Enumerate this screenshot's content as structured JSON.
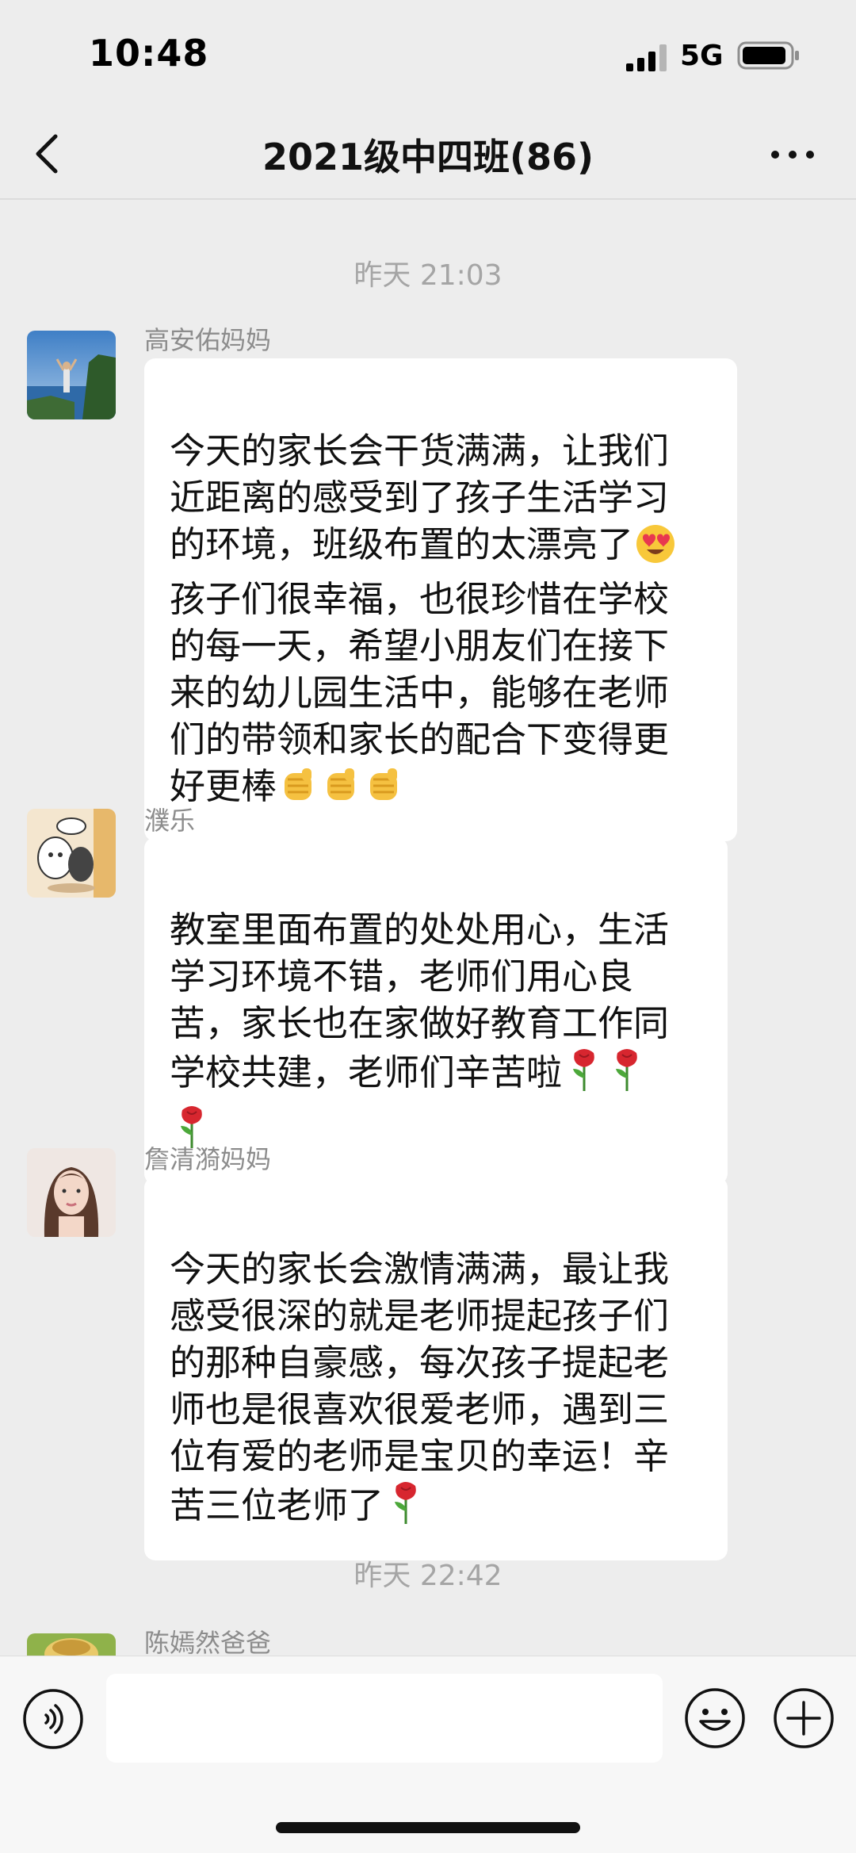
{
  "status_bar": {
    "time": "10:48",
    "network": "5G",
    "signal_icon": "signal-bars-icon",
    "battery_icon": "battery-icon"
  },
  "nav": {
    "title": "2021级中四班(86)",
    "back_icon": "chevron-left-icon",
    "more_icon": "more-dots-icon"
  },
  "messages": [
    {
      "timestamp": "昨天 21:03",
      "sender": "高安佑妈妈",
      "avatar": "landscape-photo-avatar",
      "text": "今天的家长会干货满满，让我们\n近距离的感受到了孩子生活学习\n的环境，班级布置的太漂亮了",
      "text2": "孩子们很幸福，也很珍惜在学校\n的每一天，希望小朋友们在接下\n来的幼儿园生活中，能够在老师\n们的带领和家长的配合下变得更\n好更棒",
      "emojis": [
        "heart-eyes-emoji",
        "fist-emoji",
        "fist-emoji",
        "fist-emoji"
      ]
    },
    {
      "sender": "濮乐",
      "avatar": "cartoon-animals-avatar",
      "text": "教室里面布置的处处用心，生活\n学习环境不错，老师们用心良\n苦，家长也在家做好教育工作同\n学校共建，老师们辛苦啦",
      "emojis": [
        "rose-emoji",
        "rose-emoji",
        "rose-emoji"
      ]
    },
    {
      "sender": "詹清漪妈妈",
      "avatar": "portrait-photo-avatar",
      "text": "今天的家长会激情满满，最让我\n感受很深的就是老师提起孩子们\n的那种自豪感，每次孩子提起老\n师也是很喜欢很爱老师，遇到三\n位有爱的老师是宝贝的幸运！辛\n苦三位老师了",
      "emojis": [
        "rose-emoji"
      ]
    },
    {
      "timestamp": "昨天 22:42",
      "sender": "陈嫣然爸爸",
      "avatar": "cartoon-avatar"
    }
  ],
  "input_bar": {
    "voice_icon": "voice-icon",
    "placeholder": "",
    "emoji_icon": "smiley-icon",
    "add_icon": "plus-circle-icon"
  },
  "colors": {
    "background": "#ededed",
    "bubble": "#ffffff",
    "meta_text": "#a5a5a5"
  }
}
